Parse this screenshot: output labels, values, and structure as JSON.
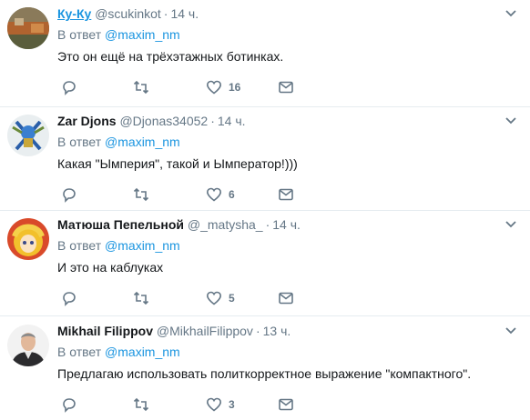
{
  "reply_prefix": "В ответ",
  "tweets": [
    {
      "name": "Ку-Ку",
      "handle": "@scukinkot",
      "time": "14 ч.",
      "mention": "@maxim_nm",
      "text": "Это он ещё на трёхэтажных ботинках.",
      "likes": "16"
    },
    {
      "name": "Zar Djons",
      "handle": "@Djonas34052",
      "time": "14 ч.",
      "mention": "@maxim_nm",
      "text": "Какая \"Ымперия\", такой и Ымператор!)))",
      "likes": "6"
    },
    {
      "name": "Матюша Пепельной",
      "handle": "@_matysha_",
      "time": "14 ч.",
      "mention": "@maxim_nm",
      "text": "И это на каблуках",
      "likes": "5"
    },
    {
      "name": "Mikhail Filippov",
      "handle": "@MikhailFilippov",
      "time": "13 ч.",
      "mention": "@maxim_nm",
      "text": "Предлагаю использовать политкорректное выражение \"компактного\".",
      "likes": "3"
    }
  ],
  "icons": {
    "reply": "reply-icon",
    "retweet": "retweet-icon",
    "like": "heart-icon",
    "dm": "envelope-icon",
    "more": "chevron-down-icon"
  },
  "colors": {
    "link": "#1b95e0",
    "secondary": "#657786",
    "text": "#14171a",
    "border": "#e6ecf0"
  }
}
